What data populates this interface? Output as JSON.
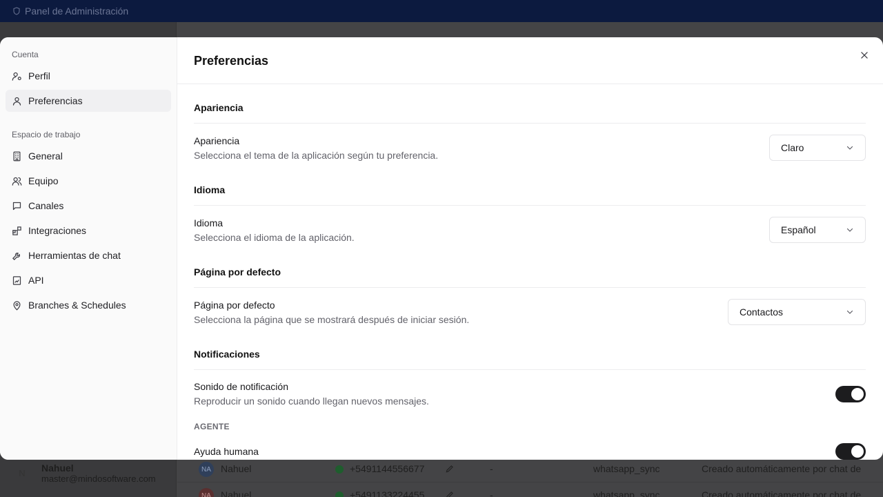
{
  "background": {
    "app_title": "Panel de Administración",
    "user": {
      "initial": "N",
      "name": "Nahuel",
      "email": "master@mindosoftware.com"
    },
    "rows": [
      {
        "avatar": "NA",
        "name": "Nahuel",
        "phone": "+5491144556677",
        "dash": "-",
        "source": "whatsapp_sync",
        "note": "Creado automáticamente por chat de",
        "avatar_color": "#2f3f5a"
      },
      {
        "avatar": "NA",
        "name": "Nahuel",
        "phone": "+5491133224455",
        "dash": "-",
        "source": "whatsapp_sync",
        "note": "Creado automáticamente por chat de",
        "avatar_color": "#5a2f2f"
      }
    ]
  },
  "sidebar": {
    "account_label": "Cuenta",
    "account_items": [
      {
        "label": "Perfil",
        "icon": "user-cog-icon"
      },
      {
        "label": "Preferencias",
        "icon": "user-icon",
        "active": true
      }
    ],
    "workspace_label": "Espacio de trabajo",
    "workspace_items": [
      {
        "label": "General",
        "icon": "building-icon"
      },
      {
        "label": "Equipo",
        "icon": "users-icon"
      },
      {
        "label": "Canales",
        "icon": "message-square-icon"
      },
      {
        "label": "Integraciones",
        "icon": "blocks-icon"
      },
      {
        "label": "Herramientas de chat",
        "icon": "wrench-icon"
      },
      {
        "label": "API",
        "icon": "file-chart-icon"
      },
      {
        "label": "Branches & Schedules",
        "icon": "map-pin-icon"
      }
    ]
  },
  "main": {
    "title": "Preferencias",
    "sections": {
      "appearance": {
        "title": "Apariencia",
        "label": "Apariencia",
        "description": "Selecciona el tema de la aplicación según tu preferencia.",
        "value": "Claro"
      },
      "language": {
        "title": "Idioma",
        "label": "Idioma",
        "description": "Selecciona el idioma de la aplicación.",
        "value": "Español"
      },
      "default_page": {
        "title": "Página por defecto",
        "label": "Página por defecto",
        "description": "Selecciona la página que se mostrará después de iniciar sesión.",
        "value": "Contactos"
      },
      "notifications": {
        "title": "Notificaciones",
        "sound_label": "Sonido de notificación",
        "sound_description": "Reproducir un sonido cuando llegan nuevos mensajes.",
        "sound_enabled": true,
        "agent_subhead": "AGENTE",
        "human_help_label": "Ayuda humana",
        "human_help_enabled": true
      }
    }
  }
}
